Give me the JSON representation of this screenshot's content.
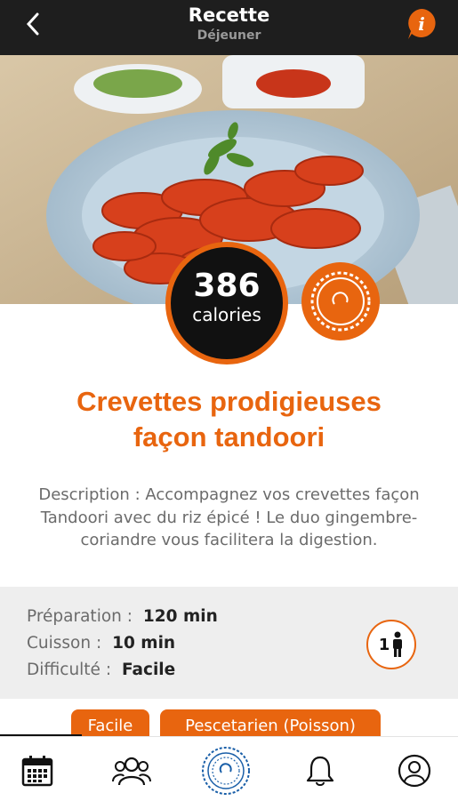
{
  "header": {
    "back_icon": "chevron-left-icon",
    "title": "Recette",
    "subtitle": "Déjeuner",
    "info_icon": "info-icon"
  },
  "hero": {
    "image_description_icon": "dish-photo"
  },
  "calories": {
    "value": "386",
    "label": "calories"
  },
  "recipe": {
    "title_line1": "Crevettes prodigieuses",
    "title_line2": "façon tandoori",
    "description": "Description : Accompagnez vos crevettes façon Tandoori avec du riz épicé ! Le duo gingembre-coriandre vous facilitera la digestion."
  },
  "info": {
    "prep_label": "Préparation :",
    "prep_value": "120 min",
    "cook_label": "Cuisson :",
    "cook_value": "10 min",
    "difficulty_label": "Difficulté :",
    "difficulty_value": "Facile",
    "servings": "1"
  },
  "tags": [
    "Facile",
    "Pescetarien (Poisson)"
  ],
  "nav": {
    "items": [
      "calendar-icon",
      "community-icon",
      "timer-logo-icon",
      "bell-icon",
      "profile-icon"
    ]
  },
  "colors": {
    "accent": "#e8650f",
    "header_bg": "#1e1e1e",
    "info_bg": "#eeeeee"
  }
}
